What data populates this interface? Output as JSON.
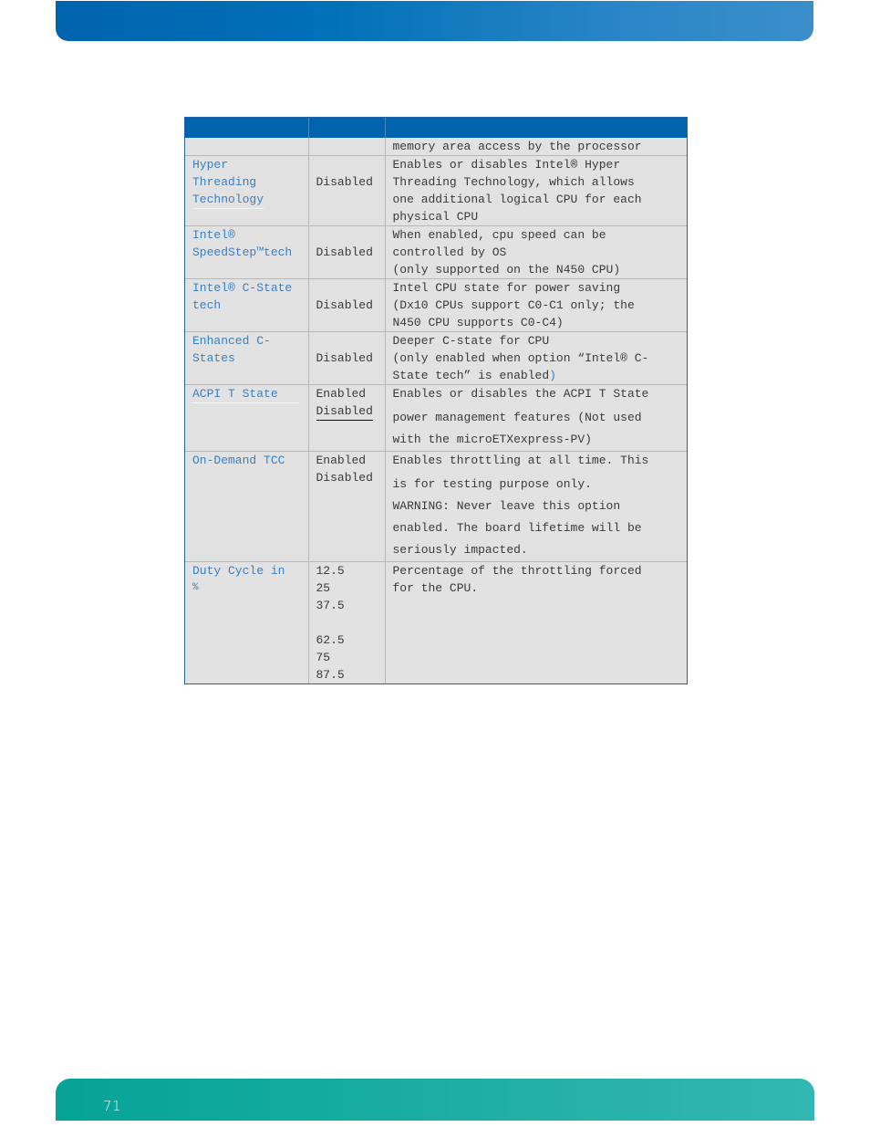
{
  "page": {
    "page_number": "71",
    "colors": {
      "top_banner": "#0063ad",
      "bottom_banner": "#14ab9f",
      "table_header": "#0063ad",
      "table_body": "#e2e2e2",
      "setting_name": "#3a7fc1",
      "text": "#3a3a3a"
    }
  },
  "table": {
    "header": [
      "",
      "",
      ""
    ],
    "rows": [
      {
        "setting": "",
        "options": [],
        "description": [
          "memory area access by the processor"
        ]
      },
      {
        "setting": "Hyper Threading Technology",
        "setting_lines": [
          "Hyper",
          "Threading",
          "Technology"
        ],
        "options": [
          "Disabled"
        ],
        "description": [
          "Enables or disables Intel® Hyper",
          "Threading Technology, which allows",
          "one additional logical CPU for each",
          "physical CPU"
        ]
      },
      {
        "setting": "Intel® SpeedStep™tech",
        "setting_lines": [
          "Intel®",
          "SpeedStep™tech"
        ],
        "options": [
          "Disabled"
        ],
        "description": [
          "When enabled, cpu speed can be",
          "controlled by OS",
          "(only supported on the N450 CPU)"
        ]
      },
      {
        "setting": "Intel® C-State tech",
        "setting_lines": [
          "Intel® C-State",
          "tech"
        ],
        "options": [
          "Disabled"
        ],
        "description": [
          "Intel CPU state for power saving",
          "(Dx10 CPUs support C0-C1 only; the",
          "N450 CPU supports C0-C4)"
        ]
      },
      {
        "setting": "Enhanced C-States",
        "setting_lines": [
          "Enhanced C-",
          "States"
        ],
        "options": [
          "Disabled"
        ],
        "description": [
          "Deeper C-state for CPU",
          "(only enabled when option “Intel® C-",
          "State tech” is enabled",
          ")"
        ]
      },
      {
        "setting": "ACPI T State",
        "setting_lines": [
          "ACPI T State"
        ],
        "options": [
          "Enabled",
          "Disabled"
        ],
        "description": [
          "Enables or disables the ACPI T State",
          "power management features  (Not used",
          "with the microETXexpress-PV)"
        ]
      },
      {
        "setting": "On-Demand TCC",
        "setting_lines": [
          "On-Demand TCC"
        ],
        "options": [
          "Enabled",
          "Disabled"
        ],
        "description": [
          "Enables throttling at all time.  This",
          "is for testing purpose only.",
          "WARNING: Never leave this option",
          "enabled.  The board lifetime will be",
          "seriously impacted."
        ]
      },
      {
        "setting": "Duty Cycle in %",
        "setting_lines": [
          "Duty Cycle in",
          "%"
        ],
        "options": [
          "12.5",
          "25",
          "37.5",
          "",
          "62.5",
          "75",
          "87.5"
        ],
        "description": [
          "Percentage of the throttling forced",
          "for the CPU."
        ]
      }
    ]
  }
}
